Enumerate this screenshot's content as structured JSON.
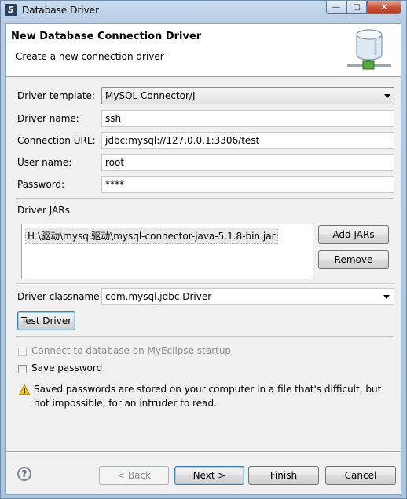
{
  "window": {
    "title": "Database Driver",
    "minimize_glyph": "—",
    "maximize_glyph": "□",
    "close_glyph": "✕"
  },
  "banner": {
    "title": "New Database Connection Driver",
    "description": "Create a new connection driver",
    "icon": "database-icon"
  },
  "form": {
    "driver_template_label": "Driver template:",
    "driver_template_value": "MySQL Connector/J",
    "driver_name_label": "Driver name:",
    "driver_name_value": "ssh",
    "connection_url_label": "Connection URL:",
    "connection_url_value": "jdbc:mysql://127.0.0.1:3306/test",
    "user_name_label": "User name:",
    "user_name_value": "root",
    "password_label": "Password:",
    "password_value": "****"
  },
  "jars": {
    "section_label": "Driver JARs",
    "items": [
      "H:\\驱动\\mysql驱动\\mysql-connector-java-5.1.8-bin.jar"
    ],
    "add_button": "Add JARs",
    "remove_button": "Remove"
  },
  "classname": {
    "label": "Driver classname:",
    "value": "com.mysql.jdbc.Driver"
  },
  "test_button": "Test Driver",
  "options": {
    "connect_on_startup_label": "Connect to database on MyEclipse startup",
    "connect_on_startup_checked": false,
    "connect_on_startup_enabled": false,
    "save_password_label": "Save password",
    "save_password_checked": false
  },
  "warning": {
    "icon": "warning-icon",
    "line1": "Saved passwords are stored on your computer in a file that's difficult, but",
    "line2": "not impossible, for an intruder to read."
  },
  "footer": {
    "help_glyph": "?",
    "back_button": "< Back",
    "next_button": "Next >",
    "finish_button": "Finish",
    "cancel_button": "Cancel"
  },
  "colors": {
    "titlebar": "#b9d1ea",
    "dialog_background": "#f0f0f0",
    "focus_border": "#3c7fb1",
    "close_button": "#c7513a",
    "warning_yellow": "#f5c400"
  }
}
